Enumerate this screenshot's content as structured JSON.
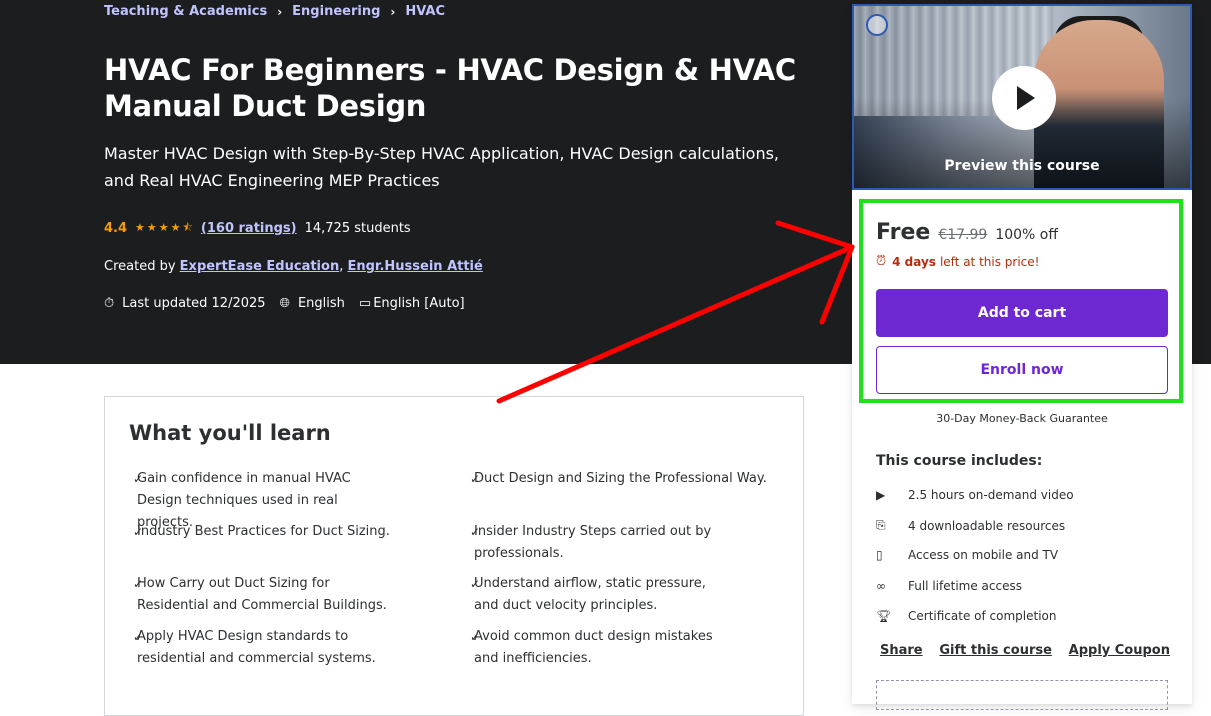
{
  "breadcrumb": [
    "Teaching & Academics",
    "Engineering",
    "HVAC"
  ],
  "course": {
    "title": "HVAC For Beginners - HVAC Design & HVAC Manual Duct Design",
    "subtitle": "Master HVAC Design with Step-By-Step HVAC Application, HVAC Design calculations, and Real HVAC Engineering MEP Practices",
    "rating": "4.4",
    "stars": 4.5,
    "ratings_link": "(160 ratings)",
    "students": "14,725 students",
    "created_by_label": "Created by",
    "authors": [
      "ExpertEase Education",
      "Engr.Hussein Attié"
    ],
    "last_updated": "Last updated 12/2025",
    "language": "English",
    "captions": "English [Auto]"
  },
  "learn": {
    "title": "What you'll learn",
    "items": [
      "Gain confidence in manual HVAC Design techniques used in real projects.",
      "Duct Design and Sizing the Professional Way.",
      "Industry Best Practices for Duct Sizing.",
      "Insider Industry Steps carried out by professionals.",
      "How Carry out Duct Sizing for Residential and Commercial Buildings.",
      "Understand airflow, static pressure, and duct velocity principles.",
      "Apply HVAC Design standards to residential and commercial systems.",
      "Avoid common duct design mistakes and inefficiencies."
    ]
  },
  "sidebar": {
    "preview_label": "Preview this course",
    "price": "Free",
    "original_price": "€17.99",
    "discount": "100% off",
    "deadline_bold": "4 days",
    "deadline_rest": "left at this price!",
    "add_to_cart": "Add to cart",
    "enroll_now": "Enroll now",
    "guarantee": "30-Day Money-Back Guarantee",
    "includes_title": "This course includes:",
    "includes": [
      {
        "icon": "video-icon",
        "text": "2.5 hours on-demand video"
      },
      {
        "icon": "download-file-icon",
        "text": "4 downloadable resources"
      },
      {
        "icon": "mobile-icon",
        "text": "Access on mobile and TV"
      },
      {
        "icon": "infinity-icon",
        "text": "Full lifetime access"
      },
      {
        "icon": "trophy-icon",
        "text": "Certificate of completion"
      }
    ],
    "actions": {
      "share": "Share",
      "gift": "Gift this course",
      "coupon": "Apply Coupon"
    }
  },
  "colors": {
    "hero_bg": "#1c1d1f",
    "accent": "#6d28d2",
    "rating": "#f69c08",
    "link": "#c0c4fc",
    "highlight_box": "#1ee01e",
    "annotation_arrow": "#ff0000"
  }
}
